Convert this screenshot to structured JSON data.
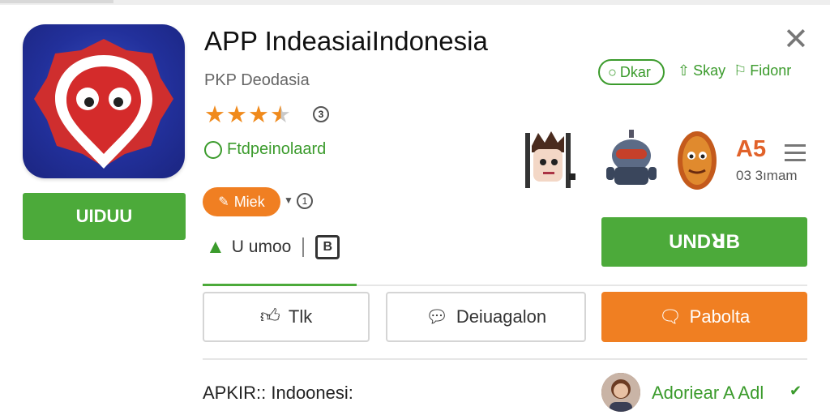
{
  "app": {
    "title": "APP IndeasiaiIndonesia",
    "developer": "PKP Deodasia",
    "rating_value": 3.5,
    "rating_info": "3",
    "feature_label": "Ftdpeinolaard"
  },
  "left": {
    "download_label": "UIDUU"
  },
  "tags": {
    "pill_label": "Miek",
    "pill_info": "1"
  },
  "meta_row": {
    "label": "U umoo",
    "book_label": "B"
  },
  "header_actions": {
    "chip_label": "Dkar",
    "link1": "Skay",
    "link2": "Fidonr"
  },
  "screenshots": {
    "items": [
      "screenshot-1",
      "screenshot-2",
      "screenshot-3"
    ]
  },
  "price": {
    "value": "A5",
    "sub": "03 3ımam"
  },
  "main": {
    "install_label": "UNDꓤB"
  },
  "actions": {
    "like": "Tlk",
    "discuss": "Deiuagalon",
    "publish": "Pabolta"
  },
  "footer": {
    "title": "APKIR:: Indoonesi:",
    "user": "Adoriear A Adl"
  },
  "colors": {
    "green": "#4caa3a",
    "orange": "#f07f22",
    "icon_blue": "#22309b",
    "icon_red": "#d42b2b"
  }
}
